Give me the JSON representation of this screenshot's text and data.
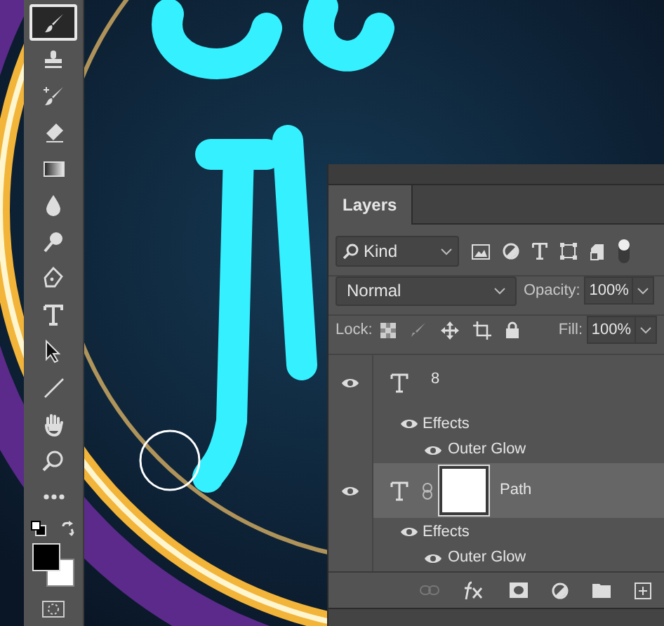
{
  "toolbar": {
    "tools": [
      {
        "selected": true
      },
      {
        "selected": false
      },
      {
        "selected": false
      },
      {
        "selected": false
      },
      {
        "selected": false
      },
      {
        "selected": false
      },
      {
        "selected": false
      },
      {
        "selected": false
      },
      {
        "selected": false
      },
      {
        "selected": false
      },
      {
        "selected": false
      },
      {
        "selected": false
      },
      {
        "selected": false
      },
      {
        "selected": false
      }
    ]
  },
  "layers_panel": {
    "tab": "Layers",
    "filter": {
      "value": "Kind"
    },
    "blend_mode": "Normal",
    "opacity": {
      "label": "Opacity:",
      "value": "100%"
    },
    "lock": {
      "label": "Lock:"
    },
    "fill": {
      "label": "Fill:",
      "value": "100%"
    },
    "layers": [
      {
        "name": "8",
        "visible": true,
        "selected": false,
        "has_mask": false,
        "effects_label": "Effects",
        "effects_visible": true,
        "effects": [
          {
            "name": "Outer Glow",
            "visible": true
          }
        ]
      },
      {
        "name": "Path",
        "visible": true,
        "selected": true,
        "has_mask": true,
        "effects_label": "Effects",
        "effects_visible": true,
        "effects": [
          {
            "name": "Outer Glow",
            "visible": true
          }
        ]
      }
    ]
  }
}
